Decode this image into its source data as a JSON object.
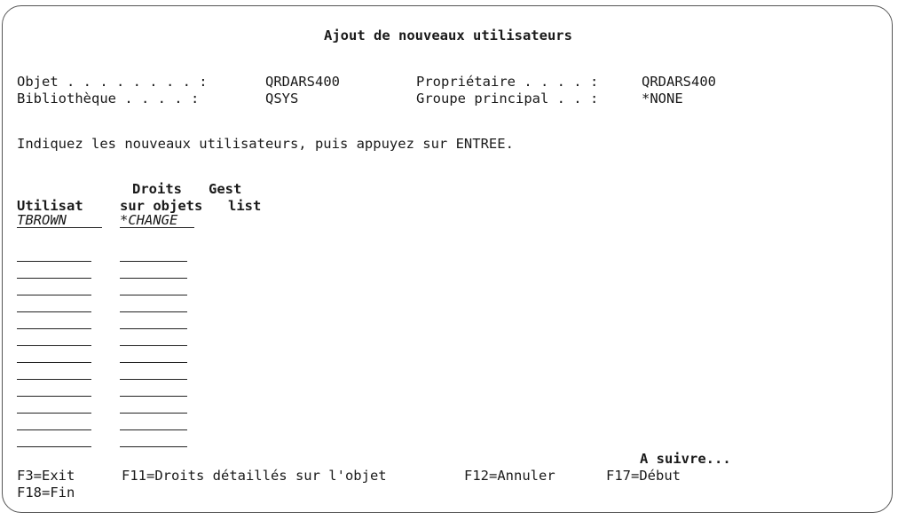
{
  "screen": {
    "title": "Ajout de nouveaux utilisateurs",
    "object_label": "Objet . . . . . . . . :",
    "object_value": "QRDARS400",
    "library_label": "Bibliothèque . . . . :",
    "library_value": "QSYS",
    "owner_label": "Propriétaire . . . . :",
    "owner_value": "QRDARS400",
    "primary_group_label": "Groupe principal . . :",
    "primary_group_value": "*NONE",
    "instruction": "Indiquez les nouveaux utilisateurs, puis appuyez sur ENTREE."
  },
  "columns": {
    "user_header": "Utilisat",
    "authority_header_line1": "Droits",
    "authority_header_line2": "sur objets",
    "list_header_line1": "Gest",
    "list_header_line2": "list"
  },
  "entries": [
    {
      "user": "TBROWN",
      "authority": "*CHANGE"
    },
    {
      "user": "",
      "authority": ""
    },
    {
      "user": "",
      "authority": ""
    },
    {
      "user": "",
      "authority": ""
    },
    {
      "user": "",
      "authority": ""
    },
    {
      "user": "",
      "authority": ""
    },
    {
      "user": "",
      "authority": ""
    },
    {
      "user": "",
      "authority": ""
    },
    {
      "user": "",
      "authority": ""
    },
    {
      "user": "",
      "authority": ""
    },
    {
      "user": "",
      "authority": ""
    },
    {
      "user": "",
      "authority": ""
    }
  ],
  "more": "A suivre...",
  "function_keys": {
    "f3": "F3=Exit",
    "f11": "F11=Droits détaillés sur l'objet",
    "f12": "F12=Annuler",
    "f17": "F17=Début",
    "f18": "F18=Fin"
  }
}
